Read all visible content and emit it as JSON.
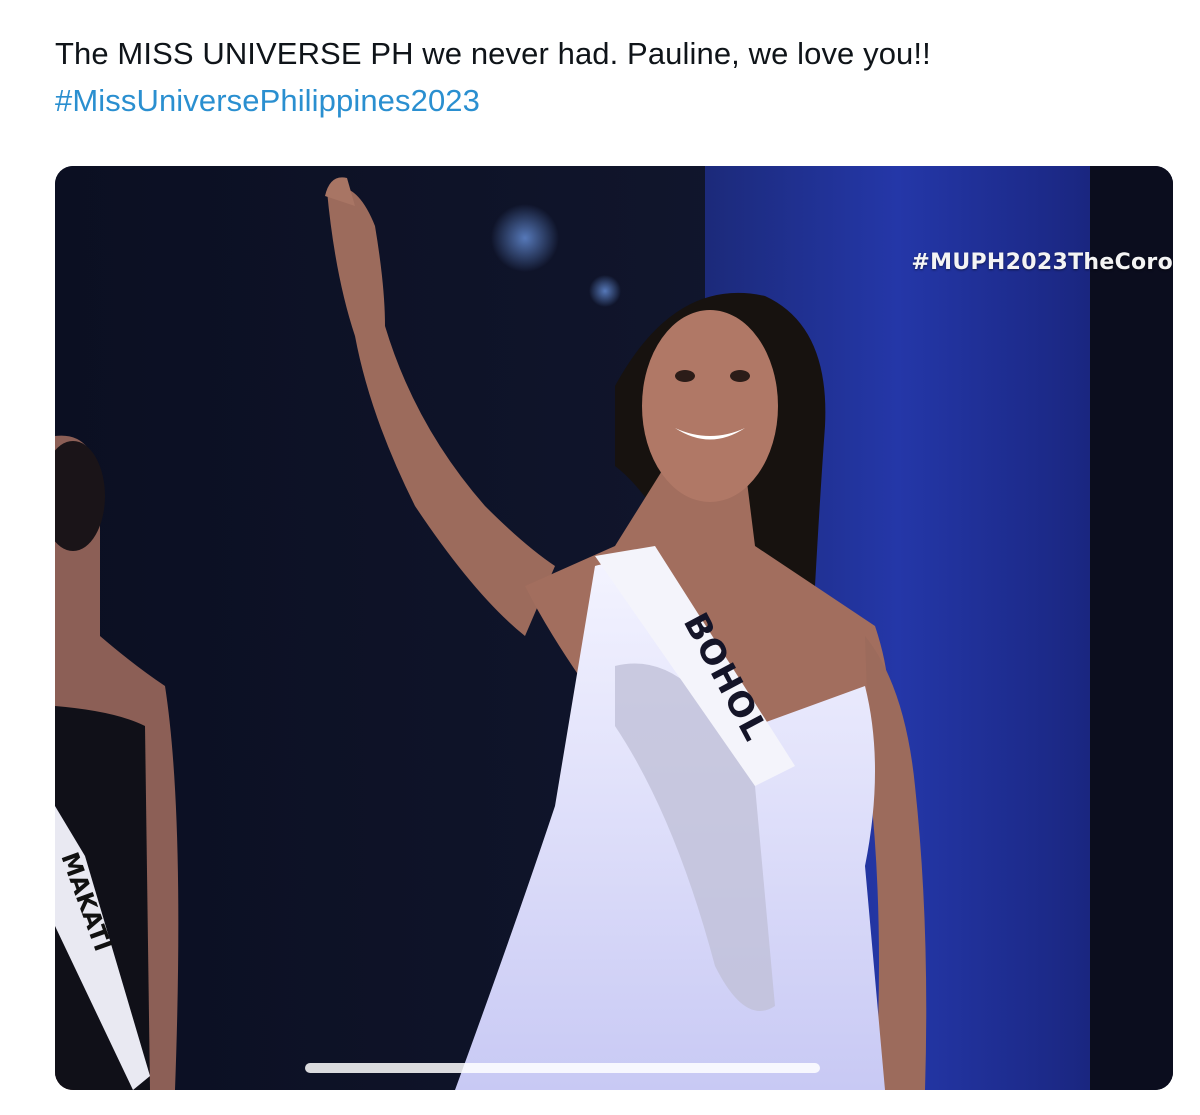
{
  "tweet": {
    "text_line1": "The MISS UNIVERSE PH we never had. Pauline, we love you!!",
    "hashtag": "#MissUniversePhilippines2023",
    "link_color": "#2a8fd0"
  },
  "media": {
    "overlay_hashtag": "#MUPH2023TheCoro",
    "sash_main": "BOHOL",
    "sash_left": "MAKATI",
    "playback_progress": 0.46
  }
}
